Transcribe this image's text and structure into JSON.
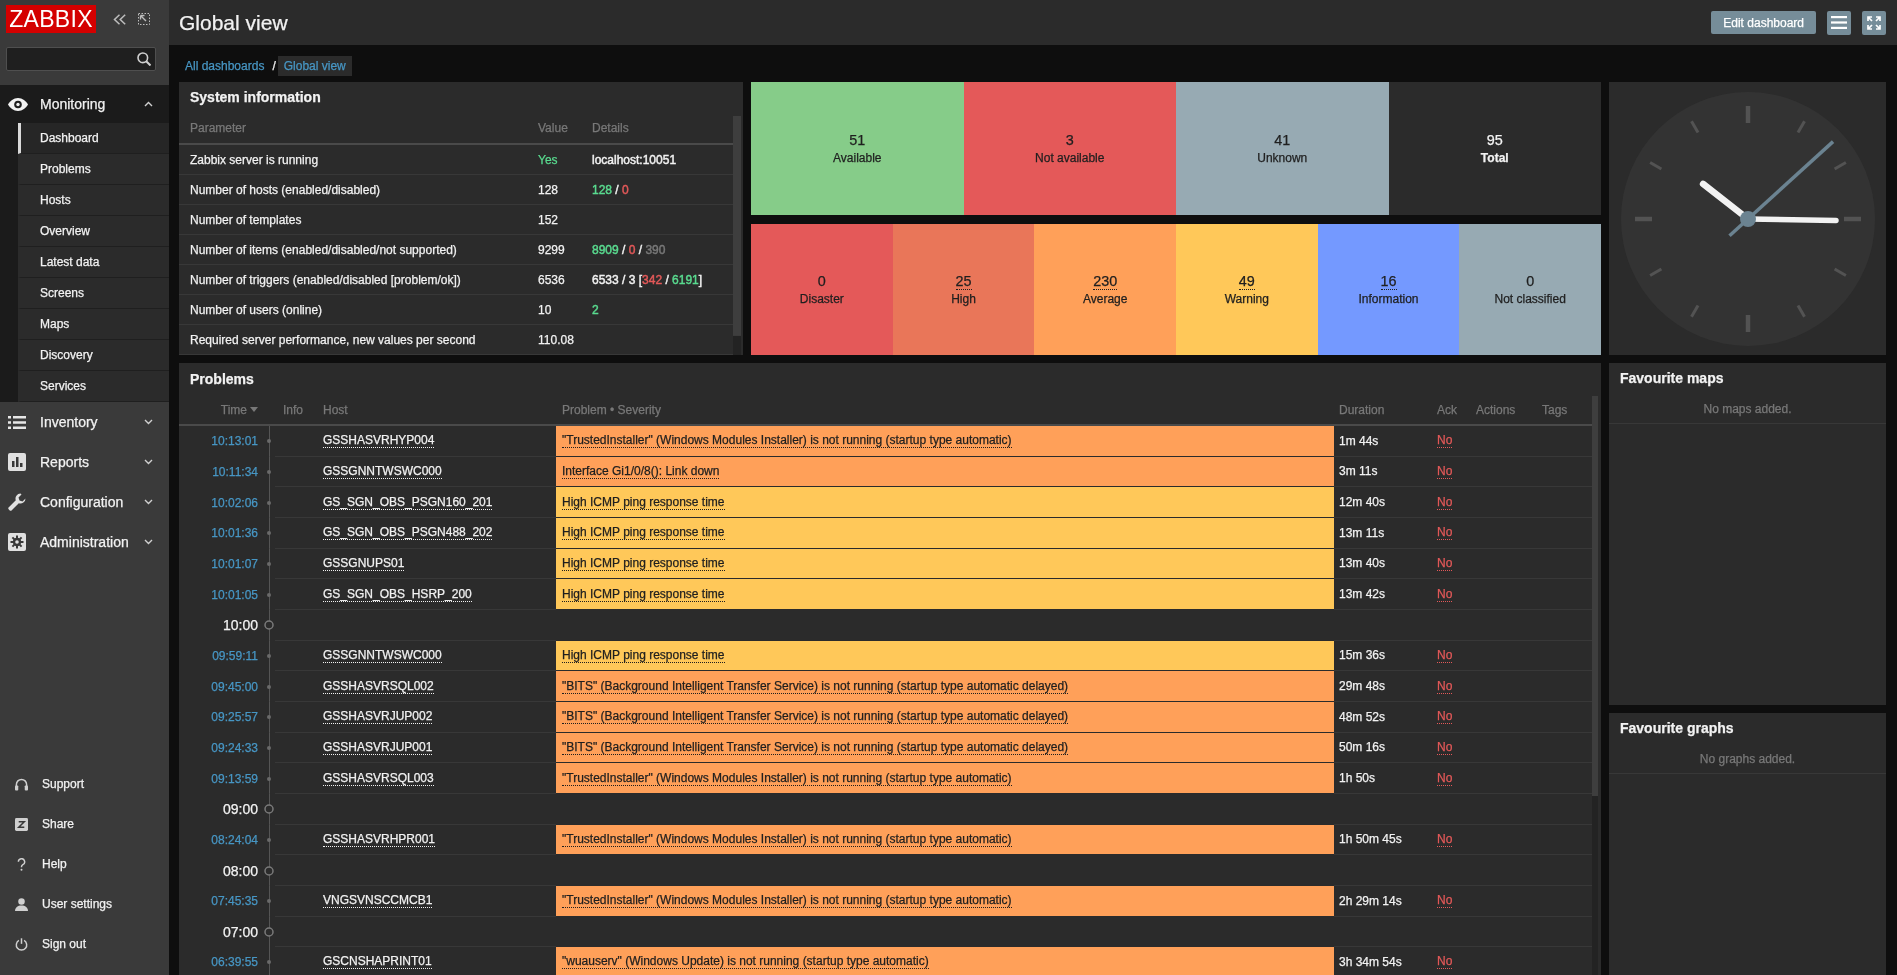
{
  "sidebar": {
    "logo": "ZABBIX",
    "menu": [
      {
        "label": "Monitoring",
        "expanded": true,
        "items": [
          {
            "label": "Dashboard",
            "selected": true
          },
          {
            "label": "Problems",
            "selected": false
          },
          {
            "label": "Hosts",
            "selected": false
          },
          {
            "label": "Overview",
            "selected": false
          },
          {
            "label": "Latest data",
            "selected": false
          },
          {
            "label": "Screens",
            "selected": false
          },
          {
            "label": "Maps",
            "selected": false
          },
          {
            "label": "Discovery",
            "selected": false
          },
          {
            "label": "Services",
            "selected": false
          }
        ]
      },
      {
        "label": "Inventory",
        "expanded": false
      },
      {
        "label": "Reports",
        "expanded": false
      },
      {
        "label": "Configuration",
        "expanded": false
      },
      {
        "label": "Administration",
        "expanded": false
      }
    ],
    "footer_links": [
      "Support",
      "Share",
      "Help",
      "User settings",
      "Sign out"
    ]
  },
  "header": {
    "title": "Global view",
    "edit_button": "Edit dashboard"
  },
  "breadcrumb": {
    "separator": "/",
    "items": [
      {
        "label": "All dashboards",
        "selected": false
      },
      {
        "label": "Global view",
        "selected": true
      }
    ]
  },
  "system_information": {
    "title": "System information",
    "columns": [
      "Parameter",
      "Value",
      "Details"
    ],
    "rows": [
      {
        "parameter": "Zabbix server is running",
        "value": {
          "text": "Yes",
          "color": "#59db8f"
        },
        "details": [
          {
            "text": "localhost:10051"
          }
        ]
      },
      {
        "parameter": "Number of hosts (enabled/disabled)",
        "value": {
          "text": "128"
        },
        "details": [
          {
            "text": "128",
            "color": "#59db8f"
          },
          {
            "text": " / "
          },
          {
            "text": "0",
            "color": "#e45959"
          }
        ]
      },
      {
        "parameter": "Number of templates",
        "value": {
          "text": "152"
        }
      },
      {
        "parameter": "Number of items (enabled/disabled/not supported)",
        "value": {
          "text": "9299"
        },
        "details": [
          {
            "text": "8909",
            "color": "#59db8f"
          },
          {
            "text": " / "
          },
          {
            "text": "0",
            "color": "#e45959"
          },
          {
            "text": " / "
          },
          {
            "text": "390",
            "color": "#787878"
          }
        ]
      },
      {
        "parameter": "Number of triggers (enabled/disabled [problem/ok])",
        "value": {
          "text": "6536"
        },
        "details": [
          {
            "text": "6533 / 3 ["
          },
          {
            "text": "342",
            "color": "#e45959"
          },
          {
            "text": " / "
          },
          {
            "text": "6191",
            "color": "#59db8f"
          },
          {
            "text": "]"
          }
        ]
      },
      {
        "parameter": "Number of users (online)",
        "value": {
          "text": "10"
        },
        "details": [
          {
            "text": "2",
            "color": "#59db8f"
          }
        ]
      },
      {
        "parameter": "Required server performance, new values per second",
        "value": {
          "text": "110.08"
        }
      }
    ]
  },
  "host_availability": {
    "items": [
      {
        "kind": "status",
        "count": "51",
        "label": "Available",
        "color": "#86cc89"
      },
      {
        "kind": "status",
        "count": "3",
        "label": "Not available",
        "color": "#e45959"
      },
      {
        "kind": "status",
        "count": "41",
        "label": "Unknown",
        "color": "#97aab3"
      },
      {
        "kind": "total",
        "count": "95",
        "label": "Total"
      }
    ]
  },
  "problems_by_severity": {
    "items": [
      {
        "count": "0",
        "label": "Disaster",
        "color": "#e45959",
        "link": false
      },
      {
        "count": "25",
        "label": "High",
        "color": "#e97659",
        "link": true
      },
      {
        "count": "230",
        "label": "Average",
        "color": "#ffa059",
        "link": true
      },
      {
        "count": "49",
        "label": "Warning",
        "color": "#ffc859",
        "link": true
      },
      {
        "count": "16",
        "label": "Information",
        "color": "#7499ff",
        "link": true
      },
      {
        "count": "0",
        "label": "Not classified",
        "color": "#97aab3",
        "link": false
      }
    ]
  },
  "problems": {
    "title": "Problems",
    "columns": [
      "Time",
      "Info",
      "Host",
      "Problem • Severity",
      "Duration",
      "Ack",
      "Actions",
      "Tags"
    ],
    "rows": [
      {
        "kind": "problem",
        "time": "10:13:01",
        "host": "GSSHASVRHYP004",
        "problem": "\"TrustedInstaller\" (Windows Modules Installer) is not running (startup type automatic)",
        "color": "#ffa059",
        "duration": "1m 44s",
        "ack": "No"
      },
      {
        "kind": "problem",
        "time": "10:11:34",
        "host": "GSSGNNTWSWC000",
        "problem": "Interface Gi1/0/8(): Link down",
        "color": "#ffa059",
        "duration": "3m 11s",
        "ack": "No"
      },
      {
        "kind": "problem",
        "time": "10:02:06",
        "host": "GS_SGN_OBS_PSGN160_201",
        "problem": "High ICMP ping response time",
        "color": "#ffc859",
        "duration": "12m 40s",
        "ack": "No"
      },
      {
        "kind": "problem",
        "time": "10:01:36",
        "host": "GS_SGN_OBS_PSGN488_202",
        "problem": "High ICMP ping response time",
        "color": "#ffc859",
        "duration": "13m 11s",
        "ack": "No"
      },
      {
        "kind": "problem",
        "time": "10:01:07",
        "host": "GSSGNUPS01",
        "problem": "High ICMP ping response time",
        "color": "#ffc859",
        "duration": "13m 40s",
        "ack": "No"
      },
      {
        "kind": "problem",
        "time": "10:01:05",
        "host": "GS_SGN_OBS_HSRP_200",
        "problem": "High ICMP ping response time",
        "color": "#ffc859",
        "duration": "13m 42s",
        "ack": "No"
      },
      {
        "kind": "marker",
        "time": "10:00"
      },
      {
        "kind": "problem",
        "time": "09:59:11",
        "host": "GSSGNNTWSWC000",
        "problem": "High ICMP ping response time",
        "color": "#ffc859",
        "duration": "15m 36s",
        "ack": "No"
      },
      {
        "kind": "problem",
        "time": "09:45:00",
        "host": "GSSHASVRSQL002",
        "problem": "\"BITS\" (Background Intelligent Transfer Service) is not running (startup type automatic delayed)",
        "color": "#ffa059",
        "duration": "29m 48s",
        "ack": "No"
      },
      {
        "kind": "problem",
        "time": "09:25:57",
        "host": "GSSHASVRJUP002",
        "problem": "\"BITS\" (Background Intelligent Transfer Service) is not running (startup type automatic delayed)",
        "color": "#ffa059",
        "duration": "48m 52s",
        "ack": "No"
      },
      {
        "kind": "problem",
        "time": "09:24:33",
        "host": "GSSHASVRJUP001",
        "problem": "\"BITS\" (Background Intelligent Transfer Service) is not running (startup type automatic delayed)",
        "color": "#ffa059",
        "duration": "50m 16s",
        "ack": "No"
      },
      {
        "kind": "problem",
        "time": "09:13:59",
        "host": "GSSHASVRSQL003",
        "problem": "\"TrustedInstaller\" (Windows Modules Installer) is not running (startup type automatic)",
        "color": "#ffa059",
        "duration": "1h 50s",
        "ack": "No"
      },
      {
        "kind": "marker",
        "time": "09:00"
      },
      {
        "kind": "problem",
        "time": "08:24:04",
        "host": "GSSHASVRHPR001",
        "problem": "\"TrustedInstaller\" (Windows Modules Installer) is not running (startup type automatic)",
        "color": "#ffa059",
        "duration": "1h 50m 45s",
        "ack": "No"
      },
      {
        "kind": "marker",
        "time": "08:00"
      },
      {
        "kind": "problem",
        "time": "07:45:35",
        "host": "VNGSVNSCCMCB1",
        "problem": "\"TrustedInstaller\" (Windows Modules Installer) is not running (startup type automatic)",
        "color": "#ffa059",
        "duration": "2h 29m 14s",
        "ack": "No"
      },
      {
        "kind": "marker",
        "time": "07:00"
      },
      {
        "kind": "problem",
        "time": "06:39:55",
        "host": "GSCNSHAPRINT01",
        "problem": "\"wuauserv\" (Windows Update) is not running (startup type automatic)",
        "color": "#ffa059",
        "duration": "3h 34m 54s",
        "ack": "No"
      }
    ]
  },
  "favourite_maps": {
    "title": "Favourite maps",
    "empty_text": "No maps added."
  },
  "favourite_graphs": {
    "title": "Favourite graphs",
    "empty_text": "No graphs added."
  }
}
